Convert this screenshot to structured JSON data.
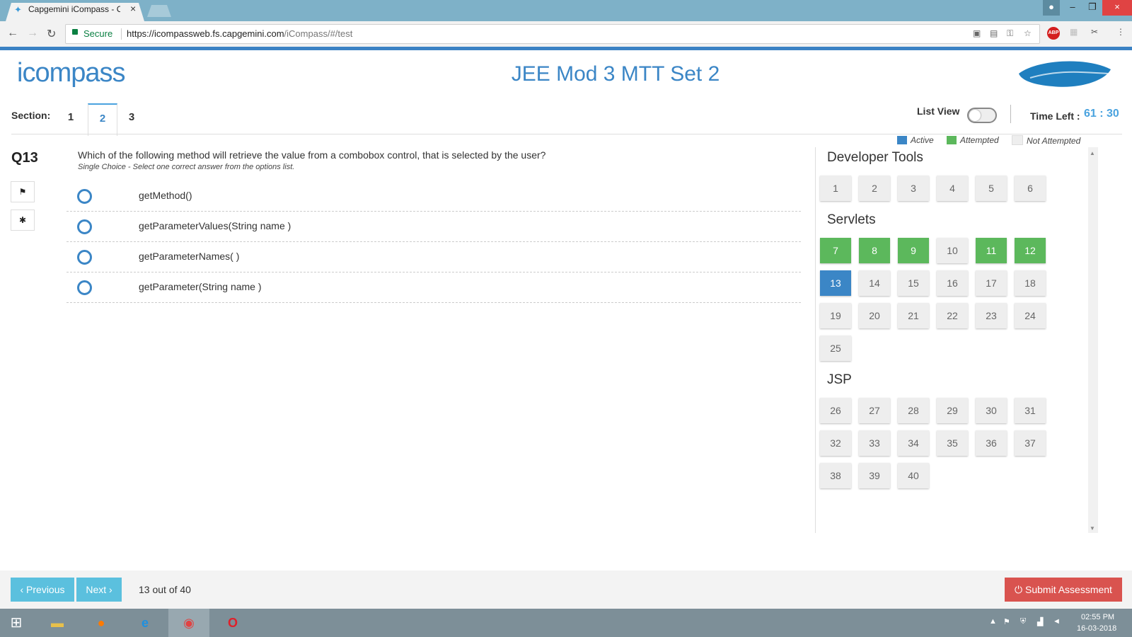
{
  "browser": {
    "tab_title": "Capgemini iCompass - C",
    "close_glyph": "×",
    "secure_label": "Secure",
    "url_host": "https://icompassweb.fs.capgemini.com",
    "url_path": "/iCompass/#/test",
    "extension_abp": "ABP"
  },
  "header": {
    "logo_text": "icompass",
    "exam_title": "JEE Mod 3 MTT Set 2"
  },
  "sections": {
    "label": "Section:",
    "tabs": [
      "1",
      "2",
      "3"
    ],
    "active": "2"
  },
  "controls": {
    "list_view_label": "List View",
    "time_left_label": "Time Left :",
    "time_left_value": "61 : 30"
  },
  "legend": {
    "active": "Active",
    "attempted": "Attempted",
    "not_attempted": "Not Attempted",
    "colors": {
      "active": "#3b86c6",
      "attempted": "#5cb85c",
      "not_attempted": "#eeeeee"
    }
  },
  "question": {
    "number": "Q13",
    "text": "Which of the following method will retrieve the value from a combobox control, that is selected by the user?",
    "hint": "Single Choice - Select one correct answer from the options list.",
    "options": [
      "getMethod()",
      "getParameterValues(String name )",
      "getParameterNames( )",
      "getParameter(String name )"
    ]
  },
  "palette": {
    "groups": [
      {
        "title": "Developer Tools",
        "items": [
          {
            "n": "1",
            "state": "none"
          },
          {
            "n": "2",
            "state": "none"
          },
          {
            "n": "3",
            "state": "none"
          },
          {
            "n": "4",
            "state": "none"
          },
          {
            "n": "5",
            "state": "none"
          },
          {
            "n": "6",
            "state": "none"
          }
        ]
      },
      {
        "title": "Servlets",
        "items": [
          {
            "n": "7",
            "state": "attempted"
          },
          {
            "n": "8",
            "state": "attempted"
          },
          {
            "n": "9",
            "state": "attempted"
          },
          {
            "n": "10",
            "state": "none"
          },
          {
            "n": "11",
            "state": "attempted"
          },
          {
            "n": "12",
            "state": "attempted"
          },
          {
            "n": "13",
            "state": "active"
          },
          {
            "n": "14",
            "state": "none"
          },
          {
            "n": "15",
            "state": "none"
          },
          {
            "n": "16",
            "state": "none"
          },
          {
            "n": "17",
            "state": "none"
          },
          {
            "n": "18",
            "state": "none"
          },
          {
            "n": "19",
            "state": "none"
          },
          {
            "n": "20",
            "state": "none"
          },
          {
            "n": "21",
            "state": "none"
          },
          {
            "n": "22",
            "state": "none"
          },
          {
            "n": "23",
            "state": "none"
          },
          {
            "n": "24",
            "state": "none"
          },
          {
            "n": "25",
            "state": "none"
          }
        ]
      },
      {
        "title": "JSP",
        "items": [
          {
            "n": "26",
            "state": "none"
          },
          {
            "n": "27",
            "state": "none"
          },
          {
            "n": "28",
            "state": "none"
          },
          {
            "n": "29",
            "state": "none"
          },
          {
            "n": "30",
            "state": "none"
          },
          {
            "n": "31",
            "state": "none"
          },
          {
            "n": "32",
            "state": "none"
          },
          {
            "n": "33",
            "state": "none"
          },
          {
            "n": "34",
            "state": "none"
          },
          {
            "n": "35",
            "state": "none"
          },
          {
            "n": "36",
            "state": "none"
          },
          {
            "n": "37",
            "state": "none"
          },
          {
            "n": "38",
            "state": "none"
          },
          {
            "n": "39",
            "state": "none"
          },
          {
            "n": "40",
            "state": "none"
          }
        ]
      }
    ]
  },
  "footer": {
    "previous_label": "‹ Previous",
    "next_label": "Next ›",
    "counter": "13 out of 40",
    "submit_label": "⏻ Submit Assessment"
  },
  "taskbar": {
    "time": "02:55 PM",
    "date": "16-03-2018"
  }
}
